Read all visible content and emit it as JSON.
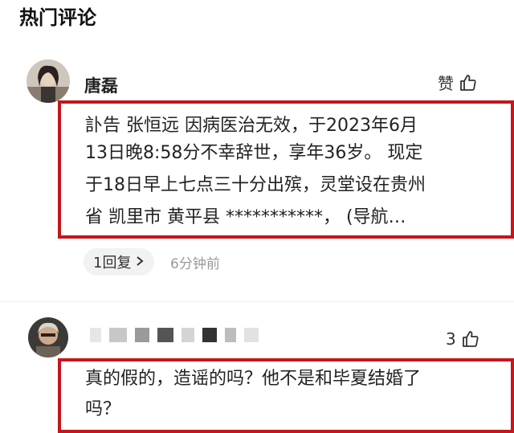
{
  "section": {
    "title": "热门评论"
  },
  "comments": [
    {
      "username": "唐磊",
      "like_label": "赞",
      "lines": [
        "訃告 张恒远 因病医治无效，于2023年6月",
        "13日晚8:58分不幸辞世，享年36岁。 现定",
        "于18日早上七点三十分出殡，灵堂设在贵州",
        "省 凯里市 黄平县 ***********，  (导航…"
      ],
      "reply_label": "1回复",
      "time": "6分钟前"
    },
    {
      "username": "",
      "like_count": "3",
      "lines": [
        "真的假的，造谣的吗？他不是和毕夏结婚了",
        "吗？"
      ]
    }
  ],
  "colors": {
    "highlight_border": "#c4161c",
    "chip_bg": "#f2f2f2",
    "muted": "#999999"
  },
  "icons": {
    "like": "thumbs-up-icon",
    "chevron": "chevron-right-icon"
  }
}
